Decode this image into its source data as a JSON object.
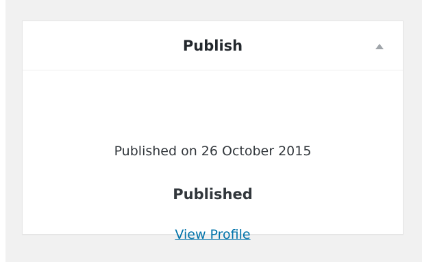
{
  "panel": {
    "title": "Publish",
    "toggle_icon": "caret-up-icon",
    "published_date": "Published on 26 October 2015",
    "status": "Published",
    "link_label": "View Profile"
  },
  "colors": {
    "background": "#f1f1f1",
    "panel_background": "#ffffff",
    "text": "#32373c",
    "link": "#0073aa",
    "icon": "#a0a5aa"
  }
}
